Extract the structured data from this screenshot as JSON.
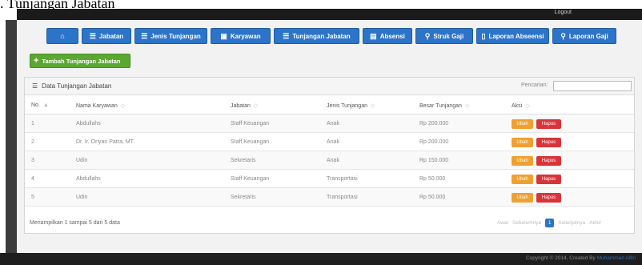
{
  "caption": ". Tunjangan Jabatan",
  "topbar": {
    "logout": "Logout"
  },
  "nav": [
    {
      "icon": "⌂",
      "label": ""
    },
    {
      "icon": "☰",
      "label": "Jabatan"
    },
    {
      "icon": "☰",
      "label": "Jenis Tunjangan"
    },
    {
      "icon": "▣",
      "label": "Karyawan"
    },
    {
      "icon": "☰",
      "label": "Tunjangan Jabatan"
    },
    {
      "icon": "▤",
      "label": "Absensi"
    },
    {
      "icon": "⚲",
      "label": "Struk Gaji"
    },
    {
      "icon": "▯",
      "label": "Laporan Abseensi"
    },
    {
      "icon": "⚲",
      "label": "Laporan Gaji"
    }
  ],
  "add_button": "Tambah Tunjangan Jabatan",
  "panel": {
    "title": "Data Tunjangan Jabatan",
    "search_label": "Pencarian:",
    "search_value": ""
  },
  "table": {
    "headers": [
      "No.",
      "Nama Karyawan",
      "Jabatan",
      "Jenis Tunjangan",
      "Besar Tunjangan",
      "Aksi"
    ],
    "rows": [
      [
        "1",
        "Abdullahs",
        "Staff Keuangan",
        "Anak",
        "Rp 200.000"
      ],
      [
        "2",
        "Dr. Ir. Oriyan Patra, MT.",
        "Staff Keuangan",
        "Anak",
        "Rp 200.000"
      ],
      [
        "3",
        "Udin",
        "Sekretaris",
        "Anak",
        "Rp 150.000"
      ],
      [
        "4",
        "Abdullahs",
        "Staff Keuangan",
        "Transportasi",
        "Rp 50.000"
      ],
      [
        "5",
        "Udin",
        "Sekretaris",
        "Transportasi",
        "Rp 50.000"
      ]
    ],
    "ubah_label": "Ubah",
    "hapus_label": "Hapus"
  },
  "info": "Menampilkan 1 sampai 5 dari 5 data",
  "pager": {
    "first": "Awal",
    "prev": "Sebelumnya",
    "current": "1",
    "next": "Selanjutnya",
    "last": "Akhir"
  },
  "footer": {
    "copyright": "Copyright © 2014, Created By",
    "author": "Muhammad Alfin"
  },
  "colors": {
    "nav_blue": "#2c74c9",
    "add_green": "#5aa832",
    "ubah_orange": "#f0a030",
    "hapus_red": "#d9343a"
  }
}
